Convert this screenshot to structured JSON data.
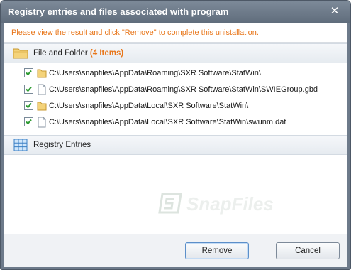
{
  "window": {
    "title": "Registry entries and files associated with program",
    "close_glyph": "✕"
  },
  "notice": "Please view the result and click \"Remove\" to complete this unistallation.",
  "file_section": {
    "label": "File and Folder",
    "count": "(4 Items)",
    "icon": "folder-icon",
    "items": [
      {
        "checked": true,
        "icon": "folder-icon",
        "path": "C:\\Users\\snapfiles\\AppData\\Roaming\\SXR Software\\StatWin\\"
      },
      {
        "checked": true,
        "icon": "file-icon",
        "path": "C:\\Users\\snapfiles\\AppData\\Roaming\\SXR Software\\StatWin\\SWIEGroup.gbd"
      },
      {
        "checked": true,
        "icon": "folder-icon",
        "path": "C:\\Users\\snapfiles\\AppData\\Local\\SXR Software\\StatWin\\"
      },
      {
        "checked": true,
        "icon": "file-icon",
        "path": "C:\\Users\\snapfiles\\AppData\\Local\\SXR Software\\StatWin\\swunm.dat"
      }
    ]
  },
  "registry_section": {
    "label": "Registry Entries",
    "icon": "grid-icon"
  },
  "watermark": "SnapFiles",
  "buttons": {
    "remove": "Remove",
    "cancel": "Cancel"
  },
  "colors": {
    "accent_orange": "#e8761a",
    "check_green": "#2e9b32",
    "title_bar": "#6d7a8a"
  }
}
